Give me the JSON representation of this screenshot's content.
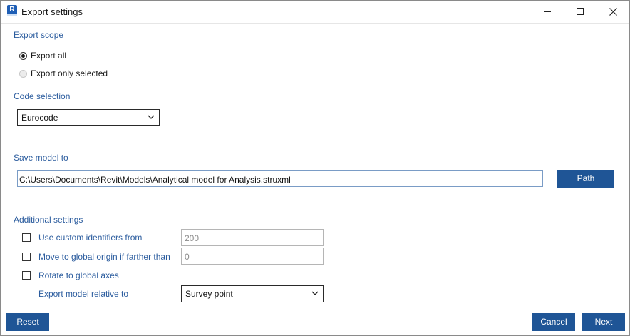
{
  "window": {
    "title": "Export settings",
    "app_icon_letter": "R"
  },
  "export_scope": {
    "label": "Export scope",
    "options": [
      {
        "label": "Export all",
        "checked": true,
        "enabled": true
      },
      {
        "label": "Export only selected",
        "checked": false,
        "enabled": false
      }
    ]
  },
  "code_selection": {
    "label": "Code selection",
    "value": "Eurocode"
  },
  "save_model": {
    "label": "Save model to",
    "path": "C:\\Users\\Documents\\Revit\\Models\\Analytical model for Analysis.struxml",
    "path_button": "Path"
  },
  "additional": {
    "label": "Additional settings",
    "custom_identifiers": {
      "label": "Use custom identifiers from",
      "checked": false,
      "value": "200"
    },
    "move_origin": {
      "label": "Move to global origin if farther than",
      "checked": false,
      "value": "0"
    },
    "rotate_axes": {
      "label": "Rotate to global axes",
      "checked": false
    },
    "relative_to": {
      "label": "Export model relative to",
      "value": "Survey point"
    }
  },
  "footer": {
    "reset": "Reset",
    "cancel": "Cancel",
    "next": "Next"
  },
  "colors": {
    "accent": "#1f5596",
    "section_label": "#2b5c9e"
  }
}
